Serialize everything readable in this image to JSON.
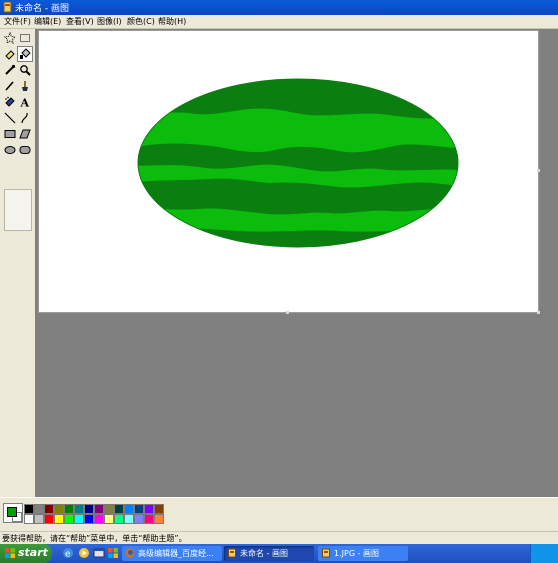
{
  "window": {
    "title": "未命名 - 画图"
  },
  "menu": [
    {
      "label": "文件(F)"
    },
    {
      "label": "编辑(E)"
    },
    {
      "label": "查看(V)"
    },
    {
      "label": "图像(I)"
    },
    {
      "label": "颜色(C)"
    },
    {
      "label": "帮助(H)"
    }
  ],
  "tools": [
    {
      "name": "free-form-select",
      "icon": "star-select-icon"
    },
    {
      "name": "rect-select",
      "icon": "rect-select-icon"
    },
    {
      "name": "eraser",
      "icon": "eraser-icon"
    },
    {
      "name": "fill",
      "icon": "paint-bucket-icon",
      "selected": true
    },
    {
      "name": "pick-color",
      "icon": "eyedropper-icon"
    },
    {
      "name": "magnifier",
      "icon": "magnifier-icon"
    },
    {
      "name": "pencil",
      "icon": "pencil-icon"
    },
    {
      "name": "brush",
      "icon": "brush-icon"
    },
    {
      "name": "airbrush",
      "icon": "airbrush-icon"
    },
    {
      "name": "text",
      "icon": "text-icon"
    },
    {
      "name": "line",
      "icon": "line-icon"
    },
    {
      "name": "curve",
      "icon": "curve-icon"
    },
    {
      "name": "rectangle",
      "icon": "rectangle-icon"
    },
    {
      "name": "polygon",
      "icon": "polygon-icon"
    },
    {
      "name": "ellipse",
      "icon": "ellipse-icon"
    },
    {
      "name": "rounded-rectangle",
      "icon": "rounded-rect-icon"
    }
  ],
  "colors": {
    "foreground": "#00a000",
    "background": "#ffffff",
    "watermelon_light": "#0cbc0c",
    "watermelon_dark": "#0a7f10",
    "palette_top": [
      "#000000",
      "#808080",
      "#800000",
      "#808000",
      "#008000",
      "#008080",
      "#000080",
      "#800080",
      "#808040",
      "#004040",
      "#0080ff",
      "#004080",
      "#8000ff",
      "#804000"
    ],
    "palette_bottom": [
      "#ffffff",
      "#c0c0c0",
      "#ff0000",
      "#ffff00",
      "#00ff00",
      "#00ffff",
      "#0000ff",
      "#ff00ff",
      "#ffff80",
      "#00ff80",
      "#80ffff",
      "#8080ff",
      "#ff0080",
      "#ff8040"
    ]
  },
  "status": {
    "text": "要获得帮助，请在“帮助”菜单中，单击“帮助主题”。"
  },
  "taskbar": {
    "start_label": "start",
    "tasks": [
      {
        "label": "高级编辑器_百度经...",
        "icon": "firefox-icon"
      },
      {
        "label": "未命名 - 画图",
        "icon": "paint-icon",
        "active": true
      },
      {
        "label": "1.JPG - 画图",
        "icon": "paint-icon"
      }
    ]
  }
}
